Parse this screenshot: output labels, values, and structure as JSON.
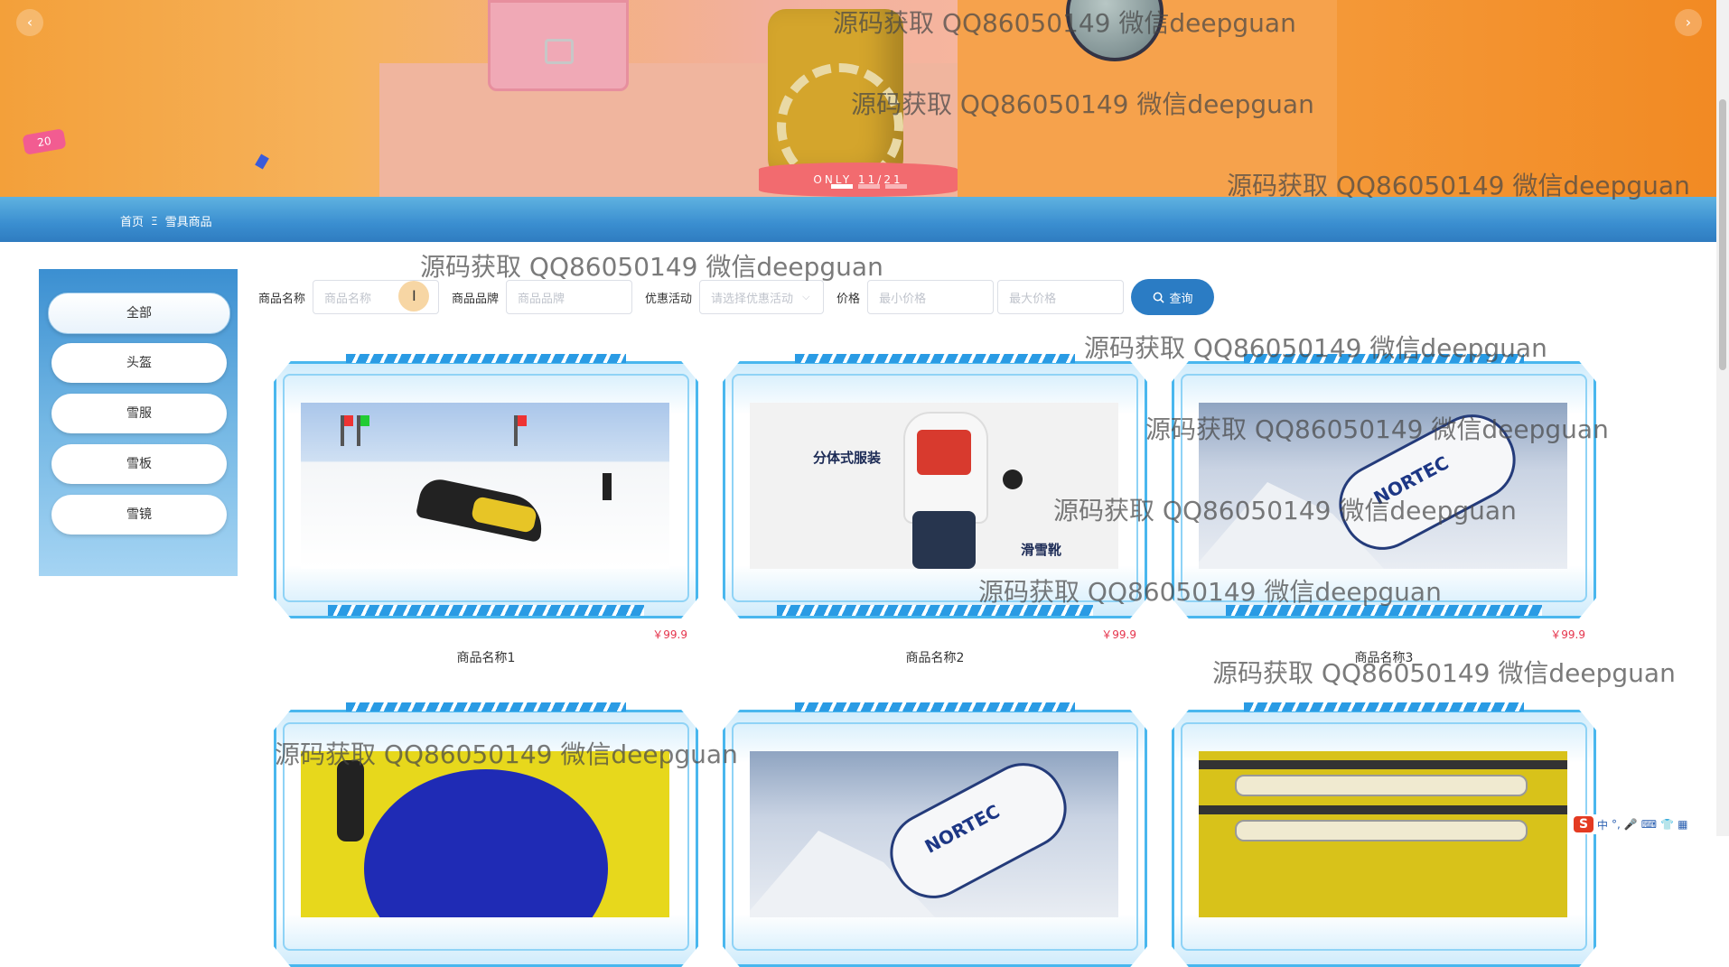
{
  "breadcrumb": {
    "home": "首页",
    "separator": "Ξ",
    "current": "雪具商品"
  },
  "sidebar": {
    "items": [
      "全部",
      "头盔",
      "雪服",
      "雪板",
      "雪镜"
    ]
  },
  "filters": {
    "name_label": "商品名称",
    "name_placeholder": "商品名称",
    "brand_label": "商品品牌",
    "brand_placeholder": "商品品牌",
    "promo_label": "优惠活动",
    "promo_placeholder": "请选择优惠活动",
    "price_label": "价格",
    "min_placeholder": "最小价格",
    "max_placeholder": "最大价格",
    "query_label": "查询"
  },
  "banner": {
    "pedestal_text": "ONLY 11/21",
    "sticker_text": "20"
  },
  "products": [
    {
      "name": "商品名称1",
      "price": "￥99.9"
    },
    {
      "name": "商品名称2",
      "price": "￥99.9"
    },
    {
      "name": "商品名称3",
      "price": "￥99.9"
    }
  ],
  "product_images": {
    "skier_label_1": "分体式服装",
    "skier_label_2": "滑雪靴",
    "gun_brand": "NORTEC"
  },
  "watermark": "源码获取 QQ86050149 微信deepguan",
  "ime": {
    "lang": "中"
  },
  "colors": {
    "accent": "#2b7cc4",
    "price": "#e5334b",
    "frame": "#49b7ee"
  }
}
